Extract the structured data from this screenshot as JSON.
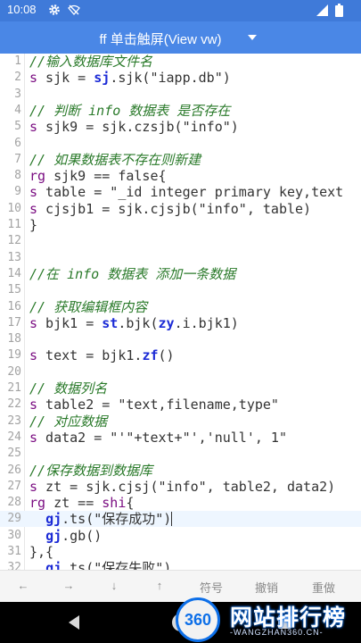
{
  "status": {
    "time": "10:08"
  },
  "app": {
    "title": "ff 单击触屏(View vw)"
  },
  "editor": {
    "lines": [
      {
        "n": "1",
        "segs": [
          {
            "t": "//输入数据库文件名",
            "c": "cm"
          }
        ]
      },
      {
        "n": "2",
        "segs": [
          {
            "t": "s",
            "c": "kw"
          },
          {
            "t": " sjk = ",
            "c": ""
          },
          {
            "t": "sj",
            "c": "fn"
          },
          {
            "t": ".sjk(\"iapp.db\")",
            "c": ""
          }
        ]
      },
      {
        "n": "3",
        "segs": []
      },
      {
        "n": "4",
        "segs": [
          {
            "t": "// 判断 info 数据表 是否存在",
            "c": "cm"
          }
        ]
      },
      {
        "n": "5",
        "segs": [
          {
            "t": "s",
            "c": "kw"
          },
          {
            "t": " sjk9 = sjk.czsjb(\"info\")",
            "c": ""
          }
        ]
      },
      {
        "n": "6",
        "segs": []
      },
      {
        "n": "7",
        "segs": [
          {
            "t": "// 如果数据表不存在则新建",
            "c": "cm"
          }
        ]
      },
      {
        "n": "8",
        "segs": [
          {
            "t": "rg",
            "c": "kw"
          },
          {
            "t": " sjk9 == false{",
            "c": ""
          }
        ]
      },
      {
        "n": "9",
        "segs": [
          {
            "t": "s",
            "c": "kw"
          },
          {
            "t": " table = \"_id integer primary key,text",
            "c": ""
          }
        ]
      },
      {
        "n": "10",
        "segs": [
          {
            "t": "s",
            "c": "kw"
          },
          {
            "t": " cjsjb1 = sjk.cjsjb(\"info\", table)",
            "c": ""
          }
        ]
      },
      {
        "n": "11",
        "segs": [
          {
            "t": "}",
            "c": ""
          }
        ]
      },
      {
        "n": "12",
        "segs": []
      },
      {
        "n": "13",
        "segs": []
      },
      {
        "n": "14",
        "segs": [
          {
            "t": "//在 info 数据表 添加一条数据",
            "c": "cm"
          }
        ]
      },
      {
        "n": "15",
        "segs": []
      },
      {
        "n": "16",
        "segs": [
          {
            "t": "// 获取编辑框内容",
            "c": "cm"
          }
        ]
      },
      {
        "n": "17",
        "segs": [
          {
            "t": "s",
            "c": "kw"
          },
          {
            "t": " bjk1 = ",
            "c": ""
          },
          {
            "t": "st",
            "c": "fn"
          },
          {
            "t": ".bjk(",
            "c": ""
          },
          {
            "t": "zy",
            "c": "fn"
          },
          {
            "t": ".i.bjk1)",
            "c": ""
          }
        ]
      },
      {
        "n": "18",
        "segs": []
      },
      {
        "n": "19",
        "segs": [
          {
            "t": "s",
            "c": "kw"
          },
          {
            "t": " text = bjk1.",
            "c": ""
          },
          {
            "t": "zf",
            "c": "fn"
          },
          {
            "t": "()",
            "c": ""
          }
        ]
      },
      {
        "n": "20",
        "segs": []
      },
      {
        "n": "21",
        "segs": [
          {
            "t": "// 数据列名",
            "c": "cm"
          }
        ]
      },
      {
        "n": "22",
        "segs": [
          {
            "t": "s",
            "c": "kw"
          },
          {
            "t": " table2 = \"text,filename,type\"",
            "c": ""
          }
        ]
      },
      {
        "n": "23",
        "segs": [
          {
            "t": "// 对应数据",
            "c": "cm"
          }
        ]
      },
      {
        "n": "24",
        "segs": [
          {
            "t": "s",
            "c": "kw"
          },
          {
            "t": " data2 = \"'\"+text+\"','null', 1\"",
            "c": ""
          }
        ]
      },
      {
        "n": "25",
        "segs": []
      },
      {
        "n": "26",
        "segs": [
          {
            "t": "//保存数据到数据库",
            "c": "cm"
          }
        ]
      },
      {
        "n": "27",
        "segs": [
          {
            "t": "s",
            "c": "kw"
          },
          {
            "t": " zt = sjk.cjsj(\"info\", table2, data2)",
            "c": ""
          }
        ]
      },
      {
        "n": "28",
        "segs": [
          {
            "t": "rg",
            "c": "kw"
          },
          {
            "t": " zt == ",
            "c": ""
          },
          {
            "t": "shi",
            "c": "kw"
          },
          {
            "t": "{",
            "c": ""
          }
        ]
      },
      {
        "n": "29",
        "segs": [
          {
            "t": "  ",
            "c": ""
          },
          {
            "t": "gj",
            "c": "fn"
          },
          {
            "t": ".ts(\"保存成功\")",
            "c": ""
          }
        ],
        "current": true
      },
      {
        "n": "30",
        "segs": [
          {
            "t": "  ",
            "c": ""
          },
          {
            "t": "gj",
            "c": "fn"
          },
          {
            "t": ".gb()",
            "c": ""
          }
        ]
      },
      {
        "n": "31",
        "segs": [
          {
            "t": "},{",
            "c": ""
          }
        ]
      },
      {
        "n": "32",
        "segs": [
          {
            "t": "  ",
            "c": ""
          },
          {
            "t": "gj",
            "c": "fn"
          },
          {
            "t": ".ts(\"保存失败\")",
            "c": ""
          }
        ]
      }
    ]
  },
  "toolbar": {
    "left": "←",
    "right": "→",
    "down": "↓",
    "up": "↑",
    "symbol": "符号",
    "undo": "撤销",
    "redo": "重做"
  },
  "watermark": {
    "num": "360",
    "brand": "网站排行榜",
    "url": "-WANGZHAN360.CN-"
  },
  "colors": {
    "status_bar": "#3f7ad9",
    "app_bar": "#4a87e6",
    "keyword": "#7b0e82",
    "comment": "#2a7a2a",
    "function": "#1c2bd6"
  }
}
